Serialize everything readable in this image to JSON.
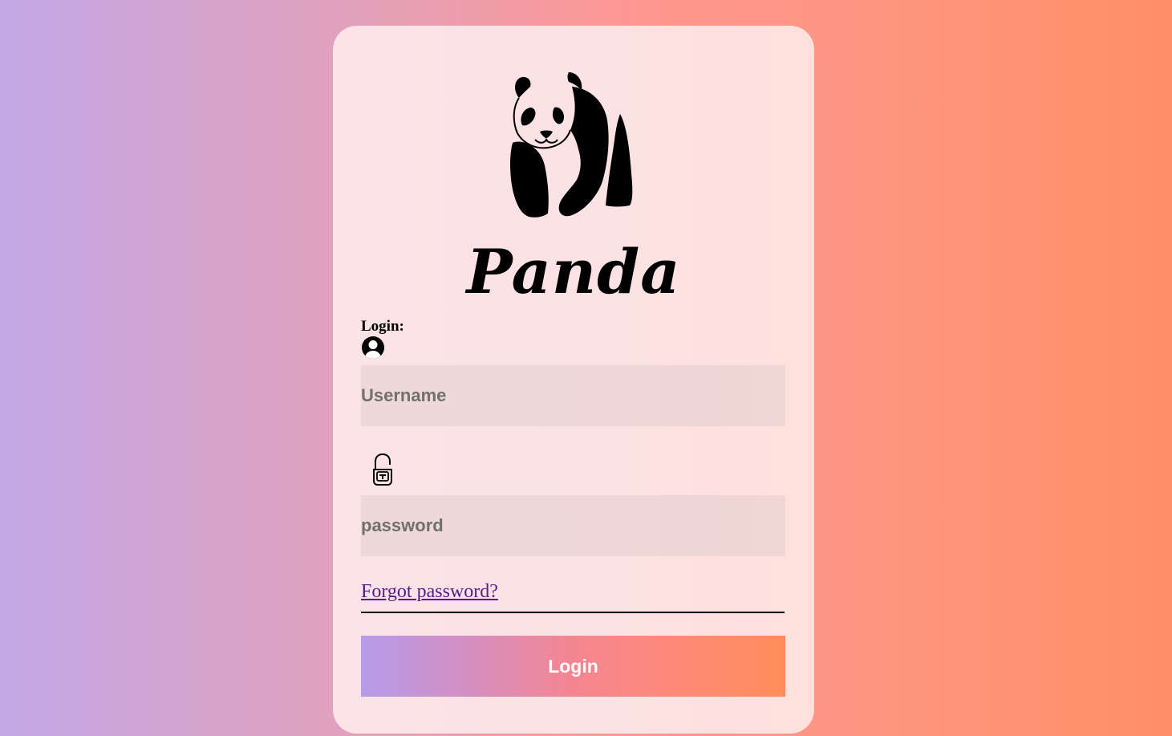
{
  "brand": {
    "name": "Panda"
  },
  "login_form": {
    "title": "Login:",
    "username_placeholder": "Username",
    "password_placeholder": "password",
    "forgot_link": "Forgot password?",
    "submit_label": "Login"
  },
  "icons": {
    "logo": "panda-icon",
    "user": "user-icon",
    "lock": "lock-icon"
  },
  "colors": {
    "link": "#551a8b",
    "button_gradient_start": "#b69bea",
    "button_gradient_end": "#ff8d5a"
  }
}
